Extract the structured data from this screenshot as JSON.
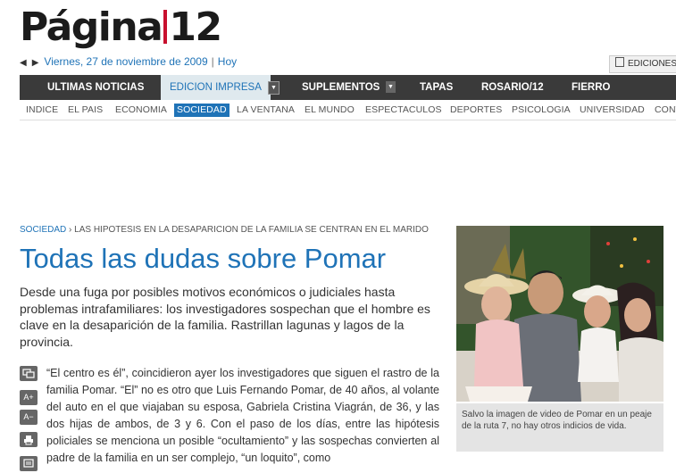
{
  "logo": {
    "left": "Página",
    "right": "12"
  },
  "dateline": {
    "date": "Viernes, 27 de noviembre de 2009",
    "separator": "|",
    "today": "Hoy"
  },
  "editions_button": "EDICIONES",
  "main_nav": [
    {
      "label": "ULTIMAS NOTICIAS"
    },
    {
      "label": "EDICION IMPRESA"
    },
    {
      "label": "SUPLEMENTOS"
    },
    {
      "label": "TAPAS"
    },
    {
      "label": "ROSARIO/12"
    },
    {
      "label": "FIERRO"
    }
  ],
  "sub_nav": [
    "INDICE",
    "EL PAIS",
    "ECONOMIA",
    "SOCIEDAD",
    "LA VENTANA",
    "EL MUNDO",
    "ESPECTACULOS",
    "DEPORTES",
    "PSICOLOGIA",
    "UNIVERSIDAD",
    "CONT"
  ],
  "breadcrumb": {
    "section": "SOCIEDAD",
    "separator": "›",
    "headline": "LAS HIPOTESIS EN LA DESAPARICION DE LA FAMILIA SE CENTRAN EN EL MARIDO"
  },
  "article": {
    "title": "Todas las dudas sobre Pomar",
    "lead": "Desde una fuga por posibles motivos económicos o judiciales hasta problemas intrafamiliares: los investigadores sospechan que el hombre es clave en la desaparición de la familia. Rastrillan lagunas y lagos de la provincia.",
    "body": "“El centro es él”, coincidieron ayer los investigadores que siguen el rastro de la familia Pomar. “El” no es otro que Luis Fernando Pomar, de 40 años, al volante del auto en el que viajaban su esposa, Gabriela Cristina Viagrán, de 36, y las dos hijas de ambos, de 3 y 6. Con el paso de los días, entre las hipótesis policiales se menciona un posible “ocultamiento” y las sospechas convierten al padre de la familia en un ser complejo, “un loquito”, como"
  },
  "tools": {
    "font_up": "A+",
    "font_down": "A−"
  },
  "photo": {
    "caption": "Salvo la imagen de video de Pomar en un peaje de la ruta 7, no hay otros indicios de vida."
  },
  "colors": {
    "link_blue": "#1f73b7",
    "nav_dark": "#3a3a3a",
    "logo_red": "#c8102e"
  }
}
